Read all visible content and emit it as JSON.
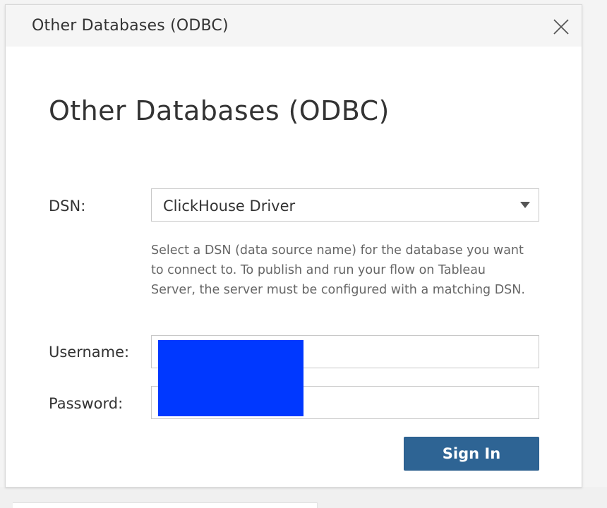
{
  "dialog": {
    "title": "Other Databases (ODBC)",
    "heading": "Other Databases (ODBC)",
    "close_icon": "close-icon"
  },
  "form": {
    "dsn_label": "DSN:",
    "dsn_value": "ClickHouse Driver",
    "dsn_dropdown_icon": "chevron-down-icon",
    "dsn_help": "Select a DSN (data source name) for the database you want to connect to. To publish and run your flow on Tableau Server, the server must be configured with a matching DSN.",
    "username_label": "Username:",
    "username_value": "",
    "password_label": "Password:",
    "password_value": "",
    "signin_label": "Sign In"
  },
  "colors": {
    "primary_button": "#2e6494",
    "redaction": "#0038ff"
  }
}
